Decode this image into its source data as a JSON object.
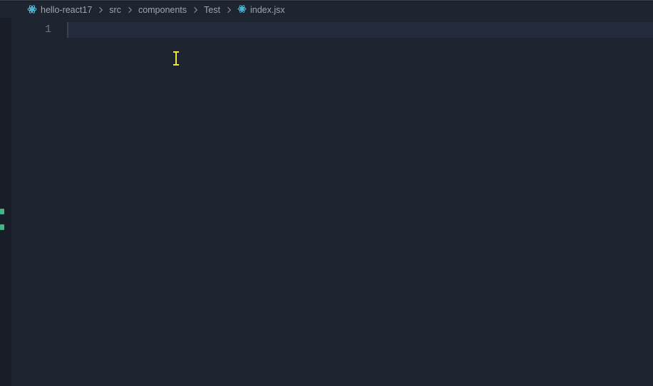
{
  "breadcrumb": {
    "items": [
      {
        "label": "hello-react17",
        "icon": "react"
      },
      {
        "label": "src",
        "icon": null
      },
      {
        "label": "components",
        "icon": null
      },
      {
        "label": "Test",
        "icon": null
      },
      {
        "label": "index.jsx",
        "icon": "react"
      }
    ]
  },
  "editor": {
    "line_numbers": [
      "1"
    ],
    "active_line": 1,
    "content": ""
  }
}
